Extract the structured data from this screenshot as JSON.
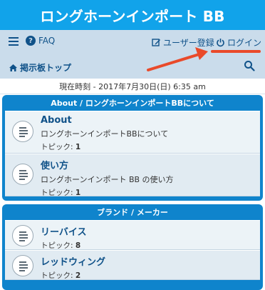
{
  "site": {
    "title": "ロングホーンインポート BB"
  },
  "nav": {
    "faq_label": "FAQ",
    "register_label": "ユーザー登録",
    "login_label": "ログイン",
    "board_index_label": "掲示板トップ"
  },
  "time": {
    "text": "現在時刻 - 2017年7月30日(日) 6:35 am"
  },
  "categories": [
    {
      "title": "About / ロングホーンインポートBBについて",
      "forums": [
        {
          "title": "About",
          "desc": "ロングホーンインポートBBについて",
          "topics_label": "トピック:",
          "topics": "1"
        },
        {
          "title": "使い方",
          "desc": "ロングホーンインポート BB の使い方",
          "topics_label": "トピック:",
          "topics": "1"
        }
      ]
    },
    {
      "title": "ブランド / メーカー",
      "forums": [
        {
          "title": "リーバイス",
          "topics_label": "トピック:",
          "topics": "8"
        },
        {
          "title": "レッドウィング",
          "topics_label": "トピック:",
          "topics": "2"
        }
      ]
    }
  ],
  "colors": {
    "header": "#11a3ea",
    "navbar": "#cadceb",
    "category": "#0f84cc",
    "link": "#105289",
    "annotation": "#e94a2a"
  }
}
